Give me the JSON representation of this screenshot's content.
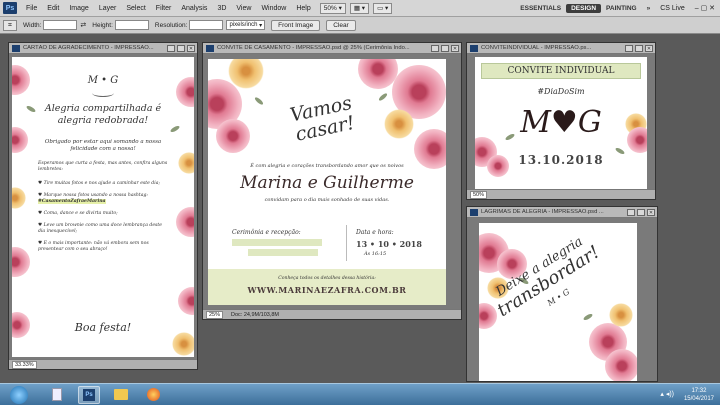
{
  "menubar": {
    "logo": "Ps",
    "items": [
      "File",
      "Edit",
      "Image",
      "Layer",
      "Select",
      "Filter",
      "Analysis",
      "3D",
      "View",
      "Window",
      "Help"
    ],
    "zoom": "50%",
    "workspaces": [
      "ESSENTIALS",
      "DESIGN",
      "PAINTING"
    ],
    "more": "»",
    "cslive": "CS Live"
  },
  "options": {
    "width_label": "Width:",
    "height_label": "Height:",
    "resolution_label": "Resolution:",
    "unit": "pixels/inch",
    "front_image": "Front Image",
    "clear": "Clear"
  },
  "win1": {
    "title": "CARTÃO DE AGRADECIMENTO - IMPRESSÃO...",
    "zoom": "33.33%",
    "monogram": "M • G",
    "heading": "Alegria compartilhada é alegria redobrada!",
    "intro": "Obrigado por estar aqui somando a nossa felicidade com a nossa!",
    "sub": "Esperamos que curta a festa, mas antes, confira alguns lembretes:",
    "items": [
      "Tire muitas fotos e nos ajude a caminhar este dia;",
      "Marque nossa fotos usando a nossa hashtag:",
      "Coma, dance e se divirta muito;",
      "Leve um brownie como uma doce lembrança deste dia inesquecível;",
      "E o mais importante: não vá embora sem nos presentear com o seu abraço!"
    ],
    "hashtag": "#CasamentoZafraeMarina",
    "closing": "Boa festa!"
  },
  "win2": {
    "title": "CONVITE DE CASAMENTO - IMPRESSÃO.psd @ 25% (Cerimônia Indo...",
    "zoom": "25%",
    "doc": "Doc: 24,9M/103,8M",
    "vamos": "Vamos casar!",
    "line1": "É com alegria e corações transbordando amor que os noivos",
    "names": "Marina e Guilherme",
    "line2": "convidam para o dia mais sonhado de suas vidas.",
    "cer_label": "Cerimônia e recepção:",
    "date_label": "Data e hora:",
    "date": "13 • 10 • 2018",
    "time": "Às 16:15",
    "footer_line": "Conheça todos os detalhes dessa história:",
    "site": "WWW.MARINAEZAFRA.COM.BR"
  },
  "win3": {
    "title": "CONVITEINDIVIDUAL - IMPRESSÃO.ps...",
    "zoom": "50%",
    "header": "CONVITE INDIVIDUAL",
    "hashtag": "#DiaDoSim",
    "monogram": "M♥G",
    "date": "13.10.2018"
  },
  "win4": {
    "title": "LÁGRIMAS DE ALEGRIA - IMPRESSÃO.psd ...",
    "line1": "Deixe a alegria",
    "line2": "transbordar!",
    "monogram": "M • G"
  },
  "taskbar": {
    "time": "17:32",
    "date": "15/04/2017"
  }
}
